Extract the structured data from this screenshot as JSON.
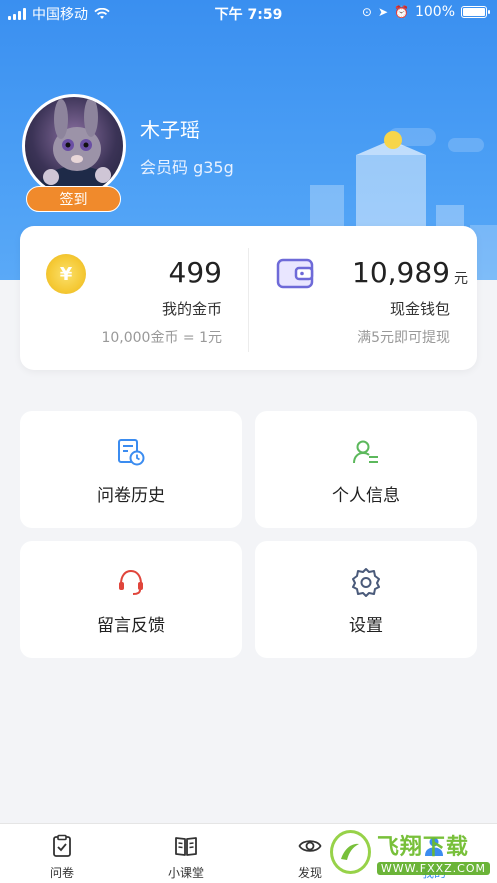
{
  "status_bar": {
    "carrier": "中国移动",
    "time": "下午 7:59",
    "battery": "100%"
  },
  "profile": {
    "username": "木子瑶",
    "member_code": "会员码 g35g",
    "signin_label": "签到"
  },
  "wallet": {
    "coins": {
      "value": "499",
      "label": "我的金币",
      "rate": "10,000金币 = 1元",
      "icon": "yuan-coin-icon",
      "symbol": "¥"
    },
    "cash": {
      "value": "10,989",
      "unit": "元",
      "label": "现金钱包",
      "note": "满5元即可提现",
      "icon": "wallet-icon"
    }
  },
  "tiles": [
    {
      "label": "问卷历史",
      "icon": "survey-history-icon",
      "color": "#3b8cf0"
    },
    {
      "label": "个人信息",
      "icon": "user-info-icon",
      "color": "#5cb85c"
    },
    {
      "label": "留言反馈",
      "icon": "headset-icon",
      "color": "#e0453b"
    },
    {
      "label": "设置",
      "icon": "gear-icon",
      "color": "#4a5a7a"
    }
  ],
  "tabbar": {
    "tabs": [
      {
        "label": "问卷",
        "icon": "clipboard-icon"
      },
      {
        "label": "小课堂",
        "icon": "book-icon"
      },
      {
        "label": "发现",
        "icon": "eye-icon"
      },
      {
        "label": "我的",
        "icon": "user-icon"
      }
    ]
  },
  "watermark": {
    "main": "飞翔下载",
    "sub": "WWW.FXXZ.COM"
  },
  "colors": {
    "hero": "#4b9ff5",
    "accent_orange": "#f08a2c",
    "active_tab": "#3b8cf0"
  }
}
